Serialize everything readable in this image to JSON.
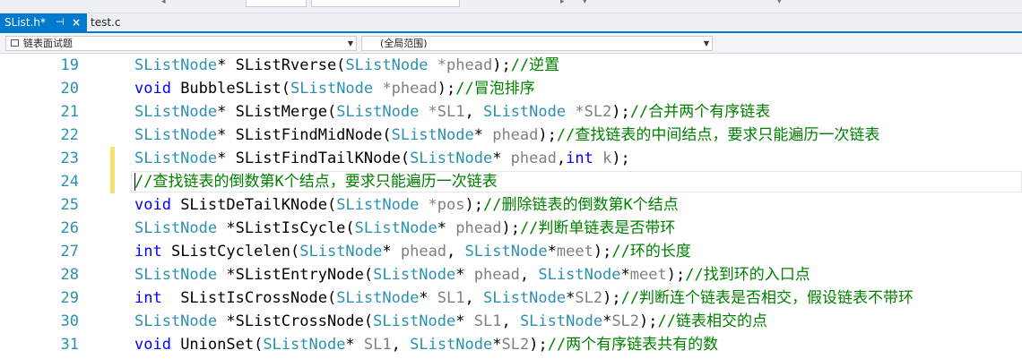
{
  "tabs": {
    "active": {
      "label": "SList.h*",
      "pin_glyph": "⊣",
      "close_glyph": "×"
    },
    "inactive": {
      "label": "test.c"
    }
  },
  "nav": {
    "scope_left": "链表面试题",
    "scope_right": "(全局范围)"
  },
  "colors": {
    "accent": "#007acc",
    "line_number": "#2b91af",
    "type": "#2b91af",
    "keyword": "#0000ff",
    "param": "#808080",
    "comment": "#008000",
    "change_marker": "#f7e36a"
  },
  "editor": {
    "lines": [
      {
        "num": "19",
        "changed": false,
        "current": false,
        "tokens": [
          {
            "k": "t",
            "s": "SListNode"
          },
          {
            "k": "x",
            "s": "* SListRverse("
          },
          {
            "k": "t",
            "s": "SListNode"
          },
          {
            "k": "p",
            "s": " *phead"
          },
          {
            "k": "x",
            "s": ");"
          },
          {
            "k": "c",
            "s": "//逆置"
          }
        ]
      },
      {
        "num": "20",
        "changed": false,
        "current": false,
        "tokens": [
          {
            "k": "k",
            "s": "void"
          },
          {
            "k": "x",
            "s": " BubbleSList("
          },
          {
            "k": "t",
            "s": "SListNode"
          },
          {
            "k": "p",
            "s": " *phead"
          },
          {
            "k": "x",
            "s": ");"
          },
          {
            "k": "c",
            "s": "//冒泡排序"
          }
        ]
      },
      {
        "num": "21",
        "changed": false,
        "current": false,
        "tokens": [
          {
            "k": "t",
            "s": "SListNode"
          },
          {
            "k": "x",
            "s": "* SListMerge("
          },
          {
            "k": "t",
            "s": "SListNode"
          },
          {
            "k": "p",
            "s": " *SL1"
          },
          {
            "k": "x",
            "s": ", "
          },
          {
            "k": "t",
            "s": "SListNode"
          },
          {
            "k": "p",
            "s": " *SL2"
          },
          {
            "k": "x",
            "s": ");"
          },
          {
            "k": "c",
            "s": "//合并两个有序链表"
          }
        ]
      },
      {
        "num": "22",
        "changed": false,
        "current": false,
        "tokens": [
          {
            "k": "t",
            "s": "SListNode"
          },
          {
            "k": "x",
            "s": "* SListFindMidNode("
          },
          {
            "k": "t",
            "s": "SListNode"
          },
          {
            "k": "x",
            "s": "*"
          },
          {
            "k": "p",
            "s": " phead"
          },
          {
            "k": "x",
            "s": ");"
          },
          {
            "k": "c",
            "s": "//查找链表的中间结点，要求只能遍历一次链表"
          }
        ]
      },
      {
        "num": "23",
        "changed": true,
        "current": false,
        "tokens": [
          {
            "k": "t",
            "s": "SListNode"
          },
          {
            "k": "x",
            "s": "* SListFindTailKNode("
          },
          {
            "k": "t",
            "s": "SListNode"
          },
          {
            "k": "x",
            "s": "*"
          },
          {
            "k": "p",
            "s": " phead"
          },
          {
            "k": "x",
            "s": ","
          },
          {
            "k": "k",
            "s": "int"
          },
          {
            "k": "p",
            "s": " k"
          },
          {
            "k": "x",
            "s": ");"
          }
        ]
      },
      {
        "num": "24",
        "changed": true,
        "current": true,
        "tokens": [
          {
            "k": "c",
            "s": "//查找链表的倒数第K个结点，要求只能遍历一次链表"
          }
        ]
      },
      {
        "num": "25",
        "changed": false,
        "current": false,
        "tokens": [
          {
            "k": "k",
            "s": "void"
          },
          {
            "k": "x",
            "s": " SListDeTailKNode("
          },
          {
            "k": "t",
            "s": "SListNode"
          },
          {
            "k": "p",
            "s": " *pos"
          },
          {
            "k": "x",
            "s": ");"
          },
          {
            "k": "c",
            "s": "//删除链表的倒数第K个结点"
          }
        ]
      },
      {
        "num": "26",
        "changed": false,
        "current": false,
        "tokens": [
          {
            "k": "t",
            "s": "SListNode"
          },
          {
            "k": "x",
            "s": " *SListIsCycle("
          },
          {
            "k": "t",
            "s": "SListNode"
          },
          {
            "k": "x",
            "s": "*"
          },
          {
            "k": "p",
            "s": " phead"
          },
          {
            "k": "x",
            "s": ");"
          },
          {
            "k": "c",
            "s": "//判断单链表是否带环"
          }
        ]
      },
      {
        "num": "27",
        "changed": false,
        "current": false,
        "tokens": [
          {
            "k": "k",
            "s": "int"
          },
          {
            "k": "x",
            "s": " SListCyclelen("
          },
          {
            "k": "t",
            "s": "SListNode"
          },
          {
            "k": "x",
            "s": "*"
          },
          {
            "k": "p",
            "s": " phead"
          },
          {
            "k": "x",
            "s": ", "
          },
          {
            "k": "t",
            "s": "SListNode"
          },
          {
            "k": "x",
            "s": "*"
          },
          {
            "k": "p",
            "s": "meet"
          },
          {
            "k": "x",
            "s": ");"
          },
          {
            "k": "c",
            "s": "//环的长度"
          }
        ]
      },
      {
        "num": "28",
        "changed": false,
        "current": false,
        "tokens": [
          {
            "k": "t",
            "s": "SListNode"
          },
          {
            "k": "x",
            "s": " *SListEntryNode("
          },
          {
            "k": "t",
            "s": "SListNode"
          },
          {
            "k": "x",
            "s": "*"
          },
          {
            "k": "p",
            "s": " phead"
          },
          {
            "k": "x",
            "s": ", "
          },
          {
            "k": "t",
            "s": "SListNode"
          },
          {
            "k": "x",
            "s": "*"
          },
          {
            "k": "p",
            "s": "meet"
          },
          {
            "k": "x",
            "s": ");"
          },
          {
            "k": "c",
            "s": "//找到环的入口点"
          }
        ]
      },
      {
        "num": "29",
        "changed": false,
        "current": false,
        "tokens": [
          {
            "k": "k",
            "s": "int"
          },
          {
            "k": "x",
            "s": "  SListIsCrossNode("
          },
          {
            "k": "t",
            "s": "SListNode"
          },
          {
            "k": "x",
            "s": "*"
          },
          {
            "k": "p",
            "s": " SL1"
          },
          {
            "k": "x",
            "s": ", "
          },
          {
            "k": "t",
            "s": "SListNode"
          },
          {
            "k": "x",
            "s": "*"
          },
          {
            "k": "p",
            "s": "SL2"
          },
          {
            "k": "x",
            "s": ");"
          },
          {
            "k": "c",
            "s": "//判断连个链表是否相交，假设链表不带环"
          }
        ]
      },
      {
        "num": "30",
        "changed": false,
        "current": false,
        "tokens": [
          {
            "k": "t",
            "s": "SListNode"
          },
          {
            "k": "x",
            "s": " *SListCrossNode("
          },
          {
            "k": "t",
            "s": "SListNode"
          },
          {
            "k": "x",
            "s": "*"
          },
          {
            "k": "p",
            "s": " SL1"
          },
          {
            "k": "x",
            "s": ", "
          },
          {
            "k": "t",
            "s": "SListNode"
          },
          {
            "k": "x",
            "s": "*"
          },
          {
            "k": "p",
            "s": "SL2"
          },
          {
            "k": "x",
            "s": ");"
          },
          {
            "k": "c",
            "s": "//链表相交的点"
          }
        ]
      },
      {
        "num": "31",
        "changed": false,
        "current": false,
        "tokens": [
          {
            "k": "k",
            "s": "void"
          },
          {
            "k": "x",
            "s": " UnionSet("
          },
          {
            "k": "t",
            "s": "SListNode"
          },
          {
            "k": "x",
            "s": "*"
          },
          {
            "k": "p",
            "s": " SL1"
          },
          {
            "k": "x",
            "s": ", "
          },
          {
            "k": "t",
            "s": "SListNode"
          },
          {
            "k": "x",
            "s": "*"
          },
          {
            "k": "p",
            "s": "SL2"
          },
          {
            "k": "x",
            "s": ");"
          },
          {
            "k": "c",
            "s": "//两个有序链表共有的数"
          }
        ]
      }
    ]
  }
}
